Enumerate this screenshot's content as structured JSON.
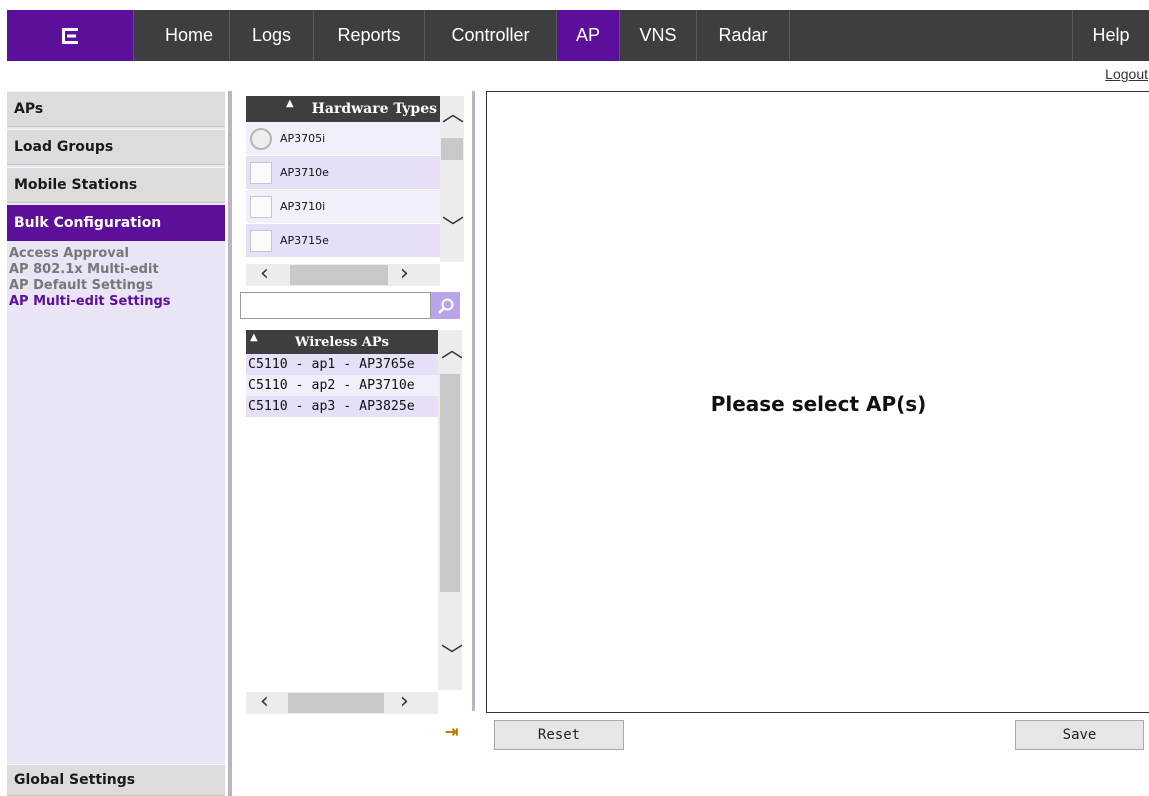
{
  "nav": {
    "logo_label": "E",
    "items": [
      "Home",
      "Logs",
      "Reports",
      "Controller",
      "AP",
      "VNS",
      "Radar"
    ],
    "help": "Help",
    "active": "AP",
    "accent": "#5b0f9a",
    "bar_color": "#3e3d40"
  },
  "logout": "Logout",
  "sidebar": {
    "items": [
      "APs",
      "Load Groups",
      "Mobile Stations",
      "Bulk Configuration"
    ],
    "active": "Bulk Configuration",
    "subitems": [
      "Access Approval",
      "AP 802.1x Multi-edit",
      "AP Default Settings",
      "AP Multi-edit Settings"
    ],
    "active_subitem": "AP Multi-edit Settings",
    "bottom_item": "Global Settings"
  },
  "hardware_panel": {
    "header": "Hardware Types",
    "rows": [
      "AP3705i",
      "AP3710e",
      "AP3710i",
      "AP3715e"
    ]
  },
  "search": {
    "value": "",
    "placeholder": ""
  },
  "wireless_panel": {
    "header": "Wireless APs",
    "rows": [
      "C5110 - ap1 - AP3765e",
      "C5110 - ap2 - AP3710e",
      "C5110 - ap3 - AP3825e"
    ]
  },
  "main": {
    "message": "Please select AP(s)"
  },
  "buttons": {
    "reset": "Reset",
    "save": "Save"
  }
}
